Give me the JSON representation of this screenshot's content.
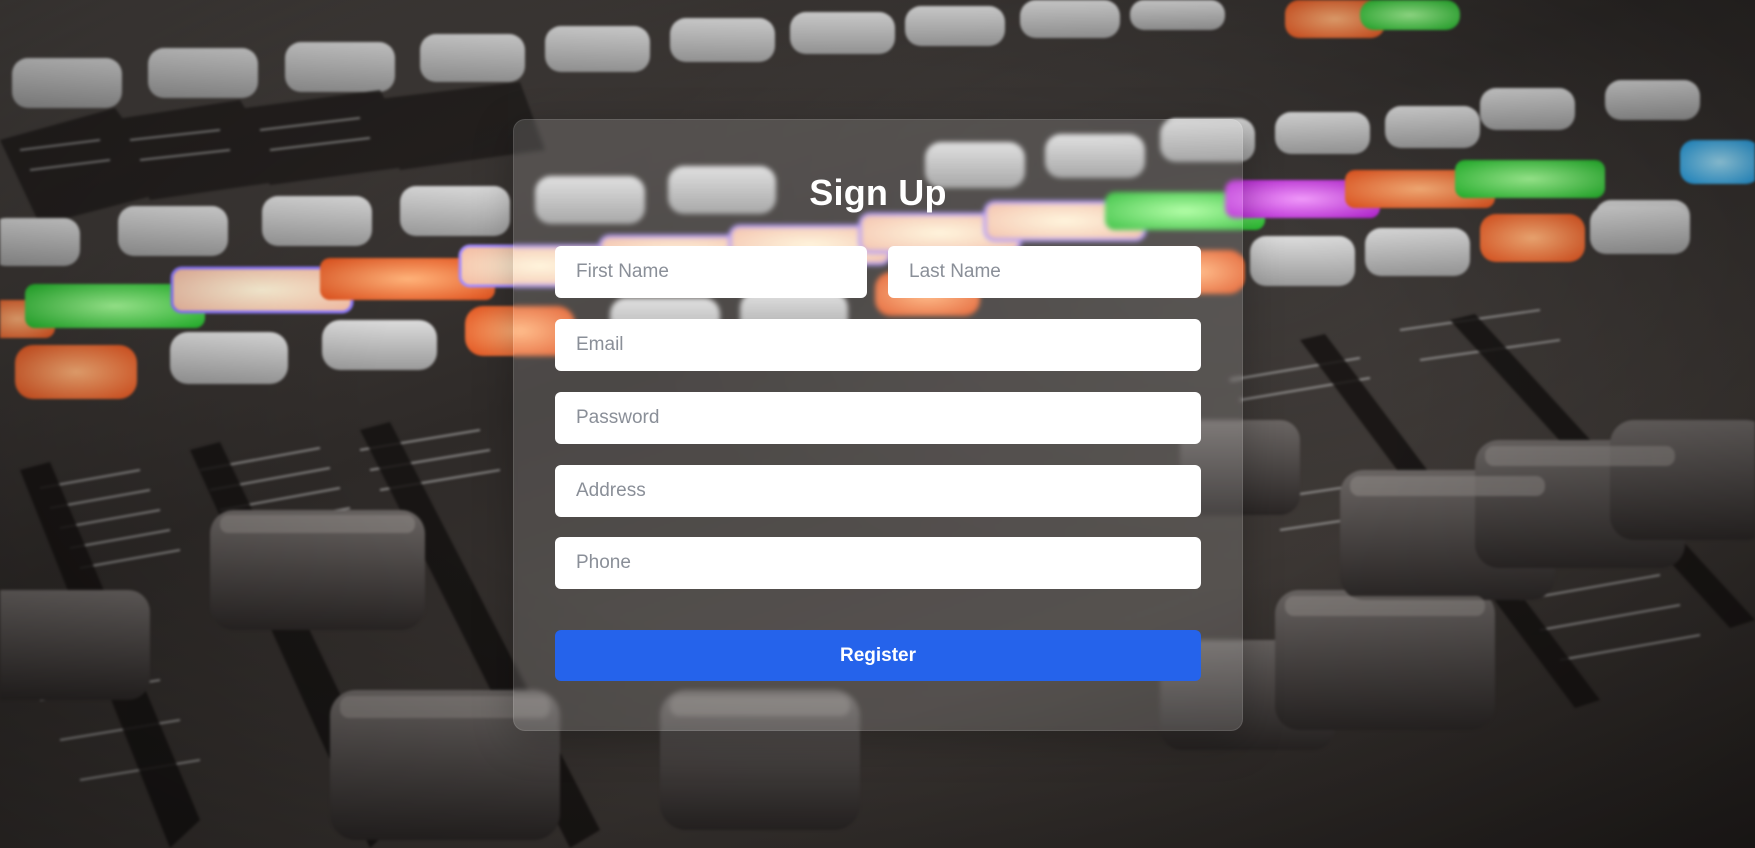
{
  "form": {
    "title": "Sign Up",
    "fields": {
      "first_name": {
        "placeholder": "First Name",
        "value": ""
      },
      "last_name": {
        "placeholder": "Last Name",
        "value": ""
      },
      "email": {
        "placeholder": "Email",
        "value": ""
      },
      "password": {
        "placeholder": "Password",
        "value": ""
      },
      "address": {
        "placeholder": "Address",
        "value": ""
      },
      "phone": {
        "placeholder": "Phone",
        "value": ""
      }
    },
    "submit_label": "Register"
  },
  "colors": {
    "accent": "#2563eb",
    "title_text": "#ffffff",
    "field_bg": "#ffffff",
    "placeholder": "#8a8f98"
  },
  "background": {
    "image": "audio mixing console",
    "icon": "mixing-console-photo"
  }
}
